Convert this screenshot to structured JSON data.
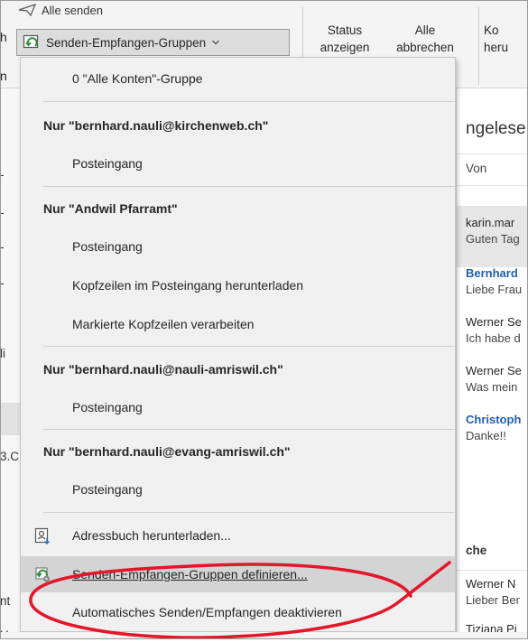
{
  "ribbon": {
    "send_all": "Alle senden",
    "groups_button": "Senden-Empfangen-Gruppen",
    "status_line1": "Status",
    "status_line2": "anzeigen",
    "cancel_line1": "Alle",
    "cancel_line2": "abbrechen",
    "ko_line1": "Ko",
    "ko_line2": "heru",
    "left_h": "h",
    "left_n": "n"
  },
  "left_strip_chars": [
    "-",
    "-",
    "-",
    "-",
    "li",
    "3.C",
    "nt",
    "Ur"
  ],
  "mail_list": {
    "title": "ngelese",
    "column_from": "Von",
    "rows": [
      {
        "sender": "karin.mar",
        "preview": "Guten Tag",
        "unread": false
      },
      {
        "sender": "Bernhard",
        "preview": "Liebe Frau",
        "unread": true
      },
      {
        "sender": "Werner Se",
        "preview": "Ich habe d",
        "unread": false
      },
      {
        "sender": "Werner Se",
        "preview": "Was mein",
        "unread": false
      },
      {
        "sender": "Christoph",
        "preview": "Danke!!",
        "unread": true
      }
    ],
    "group_label": "che",
    "rows2": [
      {
        "sender": "Werner N",
        "preview": "Lieber Ber",
        "unread": false
      },
      {
        "sender": "Tiziana Pi",
        "preview": "",
        "unread": false
      }
    ]
  },
  "menu": {
    "all_accounts": "0 \"Alle Konten\"-Gruppe",
    "acct1_header": "Nur \"bernhard.nauli@kirchenweb.ch\"",
    "acct1_inbox": "Posteingang",
    "acct2_header": "Nur \"Andwil Pfarramt\"",
    "acct2_inbox": "Posteingang",
    "acct2_download_headers": "Kopfzeilen im Posteingang herunterladen",
    "acct2_process_headers": "Markierte Kopfzeilen verarbeiten",
    "acct3_header": "Nur \"bernhard.nauli@nauli-amriswil.ch\"",
    "acct3_inbox": "Posteingang",
    "acct4_header": "Nur \"bernhard.nauli@evang-amriswil.ch\"",
    "acct4_inbox": "Posteingang",
    "address_book": "Adressbuch herunterladen...",
    "define_groups": "Senden-Empfangen-Gruppen definieren...",
    "auto_sr": "Automatisches Senden/Empfangen deaktivieren"
  },
  "colors": {
    "menu_bg": "#f0f0f0",
    "highlight": "#d4d4d4",
    "annotation": "#e3162a",
    "link_blue": "#1f5fae"
  }
}
